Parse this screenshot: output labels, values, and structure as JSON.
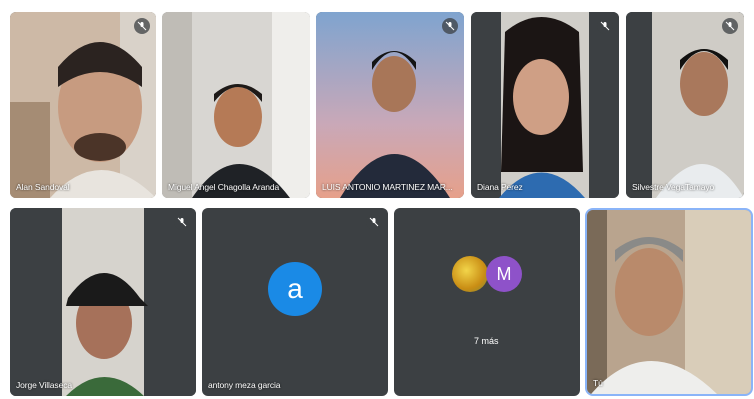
{
  "participants": [
    {
      "name": "Alan Sandoval",
      "muted": true
    },
    {
      "name": "Miguel Angel Chagolla Aranda",
      "muted": false
    },
    {
      "name": "LUIS ANTONIO MARTINEZ MAR...",
      "muted": true
    },
    {
      "name": "Diana Perez",
      "muted": true
    },
    {
      "name": "Silvestre VegaTamayo",
      "muted": true
    },
    {
      "name": "Jorge Villaseca",
      "muted": true
    },
    {
      "name": "antony meza garcia",
      "muted": true,
      "avatar_letter": "a"
    },
    {
      "name": "Tú",
      "muted": false
    }
  ],
  "others": {
    "label": "7 más",
    "avatar_letter": "M"
  },
  "colors": {
    "tile_bg": "#3c4043",
    "avatar_blue": "#1a8ae6",
    "avatar_purple": "#8e52c9",
    "self_outline": "#8ab4f8"
  }
}
